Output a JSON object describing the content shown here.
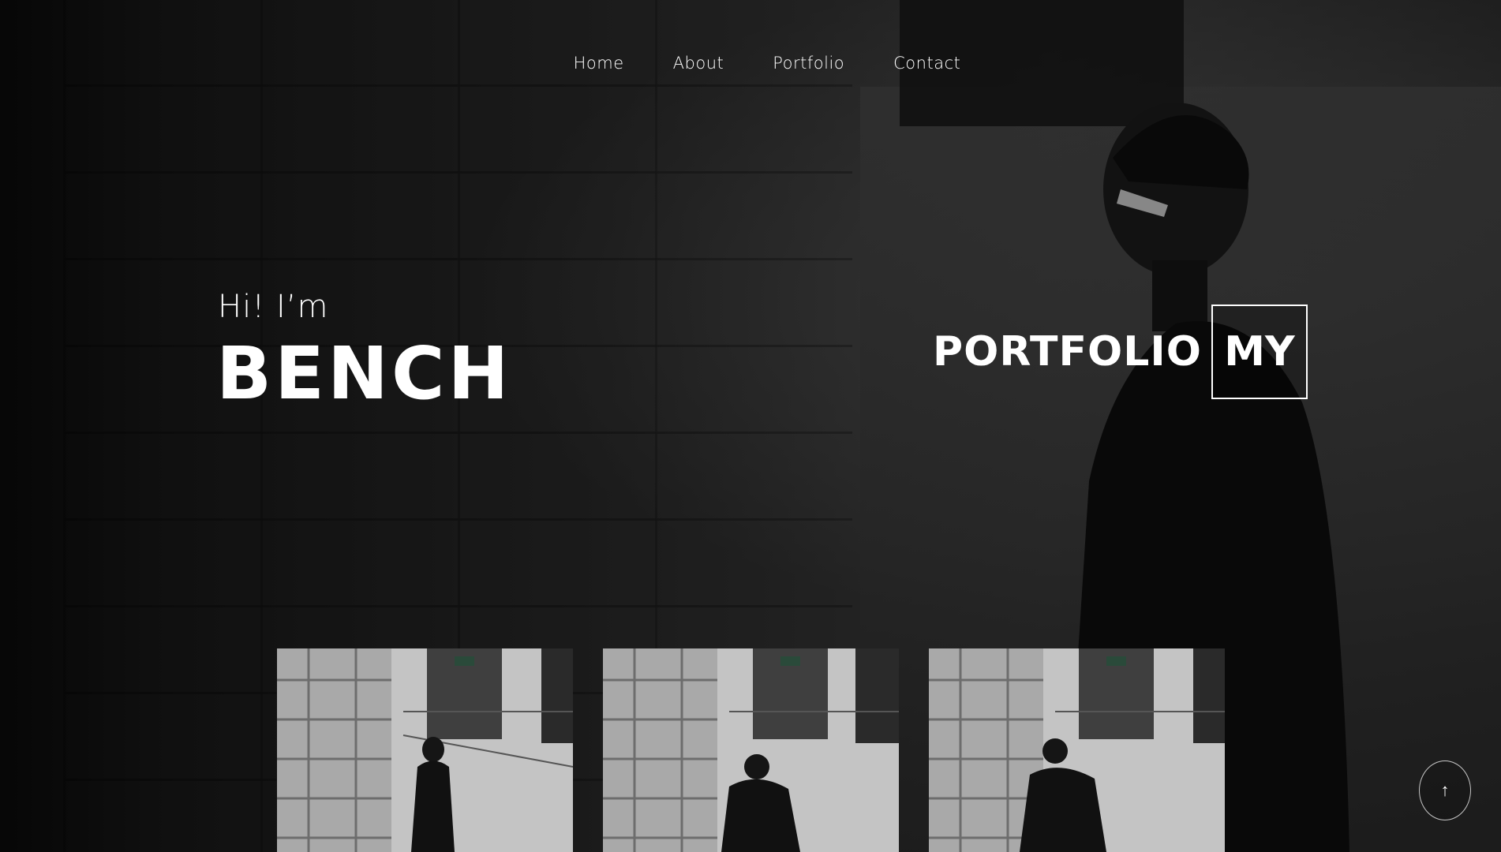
{
  "nav": {
    "items": [
      {
        "label": "Home"
      },
      {
        "label": "About"
      },
      {
        "label": "Portfolio"
      },
      {
        "label": "Contact"
      }
    ]
  },
  "hero": {
    "greeting": "Hi! I’m",
    "name": "BENCH",
    "portfolio_word": "PORTFOLIO",
    "portfolio_box": "MY"
  },
  "gallery": {
    "items": [
      {
        "icon": "photo-person-looking-up"
      },
      {
        "icon": "photo-person-back"
      },
      {
        "icon": "photo-person-walking"
      }
    ]
  },
  "scroll_top": {
    "icon": "arrow-up-icon",
    "glyph": "↑"
  }
}
